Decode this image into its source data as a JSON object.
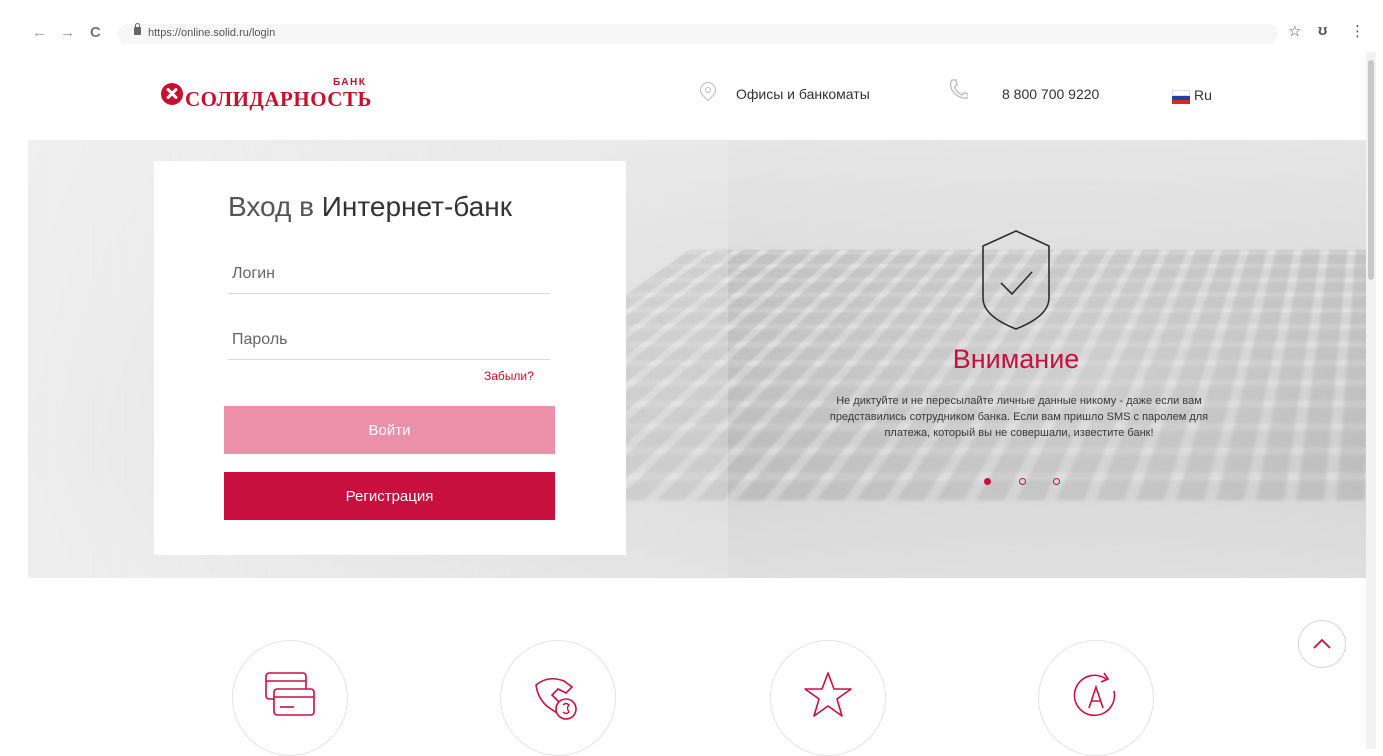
{
  "browser": {
    "url": "https://online.solid.ru/login",
    "back_icon": "←",
    "forward_icon": "→",
    "reload_icon": "C",
    "bookmark_icon": "☆",
    "profile_icon": "ʊ",
    "menu_icon": "⋮"
  },
  "header": {
    "logo_bank": "БАНК",
    "logo_name": "СОЛИДАРНОСТЬ",
    "offices_label": "Офисы и банкоматы",
    "phone": "8 800 700 9220",
    "language": "Ru"
  },
  "login": {
    "title_part1": "Вход в ",
    "title_part2": "Интернет-банк",
    "login_placeholder": "Логин",
    "password_placeholder": "Пароль",
    "forgot_label": "Забыли?",
    "submit_label": "Войти",
    "register_label": "Регистрация"
  },
  "attention": {
    "title": "Внимание",
    "text": "Не диктуйте и не пересылайте личные данные никому - даже если вам представились сотрудником банка. Если вам пришло SMS с паролем для платежа, который вы не совершали, известите банк!",
    "slides_total": 3,
    "active_slide": 1
  },
  "features": [
    {
      "icon": "cards-icon"
    },
    {
      "icon": "hand-coin-icon"
    },
    {
      "icon": "star-icon"
    },
    {
      "icon": "auto-renew-icon"
    }
  ],
  "colors": {
    "brand": "#c8102e",
    "button_disabled": "#ec8fa8",
    "button_primary": "#c8103f"
  }
}
